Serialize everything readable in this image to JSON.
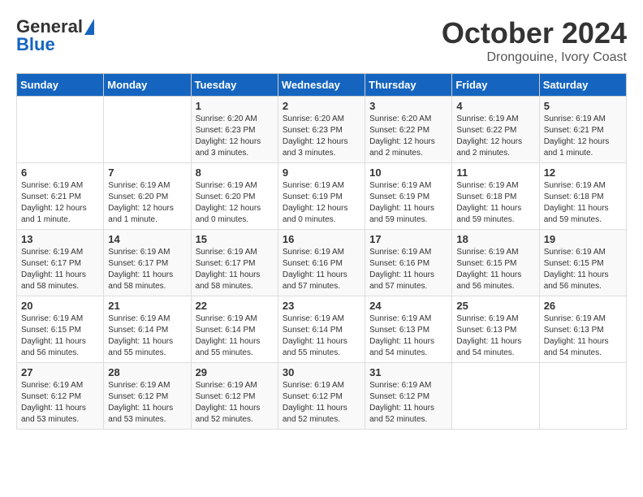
{
  "header": {
    "logo_line1": "General",
    "logo_line2": "Blue",
    "month": "October 2024",
    "location": "Drongouine, Ivory Coast"
  },
  "days_of_week": [
    "Sunday",
    "Monday",
    "Tuesday",
    "Wednesday",
    "Thursday",
    "Friday",
    "Saturday"
  ],
  "weeks": [
    [
      {
        "day": "",
        "info": ""
      },
      {
        "day": "",
        "info": ""
      },
      {
        "day": "1",
        "info": "Sunrise: 6:20 AM\nSunset: 6:23 PM\nDaylight: 12 hours and 3 minutes."
      },
      {
        "day": "2",
        "info": "Sunrise: 6:20 AM\nSunset: 6:23 PM\nDaylight: 12 hours and 3 minutes."
      },
      {
        "day": "3",
        "info": "Sunrise: 6:20 AM\nSunset: 6:22 PM\nDaylight: 12 hours and 2 minutes."
      },
      {
        "day": "4",
        "info": "Sunrise: 6:19 AM\nSunset: 6:22 PM\nDaylight: 12 hours and 2 minutes."
      },
      {
        "day": "5",
        "info": "Sunrise: 6:19 AM\nSunset: 6:21 PM\nDaylight: 12 hours and 1 minute."
      }
    ],
    [
      {
        "day": "6",
        "info": "Sunrise: 6:19 AM\nSunset: 6:21 PM\nDaylight: 12 hours and 1 minute."
      },
      {
        "day": "7",
        "info": "Sunrise: 6:19 AM\nSunset: 6:20 PM\nDaylight: 12 hours and 1 minute."
      },
      {
        "day": "8",
        "info": "Sunrise: 6:19 AM\nSunset: 6:20 PM\nDaylight: 12 hours and 0 minutes."
      },
      {
        "day": "9",
        "info": "Sunrise: 6:19 AM\nSunset: 6:19 PM\nDaylight: 12 hours and 0 minutes."
      },
      {
        "day": "10",
        "info": "Sunrise: 6:19 AM\nSunset: 6:19 PM\nDaylight: 11 hours and 59 minutes."
      },
      {
        "day": "11",
        "info": "Sunrise: 6:19 AM\nSunset: 6:18 PM\nDaylight: 11 hours and 59 minutes."
      },
      {
        "day": "12",
        "info": "Sunrise: 6:19 AM\nSunset: 6:18 PM\nDaylight: 11 hours and 59 minutes."
      }
    ],
    [
      {
        "day": "13",
        "info": "Sunrise: 6:19 AM\nSunset: 6:17 PM\nDaylight: 11 hours and 58 minutes."
      },
      {
        "day": "14",
        "info": "Sunrise: 6:19 AM\nSunset: 6:17 PM\nDaylight: 11 hours and 58 minutes."
      },
      {
        "day": "15",
        "info": "Sunrise: 6:19 AM\nSunset: 6:17 PM\nDaylight: 11 hours and 58 minutes."
      },
      {
        "day": "16",
        "info": "Sunrise: 6:19 AM\nSunset: 6:16 PM\nDaylight: 11 hours and 57 minutes."
      },
      {
        "day": "17",
        "info": "Sunrise: 6:19 AM\nSunset: 6:16 PM\nDaylight: 11 hours and 57 minutes."
      },
      {
        "day": "18",
        "info": "Sunrise: 6:19 AM\nSunset: 6:15 PM\nDaylight: 11 hours and 56 minutes."
      },
      {
        "day": "19",
        "info": "Sunrise: 6:19 AM\nSunset: 6:15 PM\nDaylight: 11 hours and 56 minutes."
      }
    ],
    [
      {
        "day": "20",
        "info": "Sunrise: 6:19 AM\nSunset: 6:15 PM\nDaylight: 11 hours and 56 minutes."
      },
      {
        "day": "21",
        "info": "Sunrise: 6:19 AM\nSunset: 6:14 PM\nDaylight: 11 hours and 55 minutes."
      },
      {
        "day": "22",
        "info": "Sunrise: 6:19 AM\nSunset: 6:14 PM\nDaylight: 11 hours and 55 minutes."
      },
      {
        "day": "23",
        "info": "Sunrise: 6:19 AM\nSunset: 6:14 PM\nDaylight: 11 hours and 55 minutes."
      },
      {
        "day": "24",
        "info": "Sunrise: 6:19 AM\nSunset: 6:13 PM\nDaylight: 11 hours and 54 minutes."
      },
      {
        "day": "25",
        "info": "Sunrise: 6:19 AM\nSunset: 6:13 PM\nDaylight: 11 hours and 54 minutes."
      },
      {
        "day": "26",
        "info": "Sunrise: 6:19 AM\nSunset: 6:13 PM\nDaylight: 11 hours and 54 minutes."
      }
    ],
    [
      {
        "day": "27",
        "info": "Sunrise: 6:19 AM\nSunset: 6:12 PM\nDaylight: 11 hours and 53 minutes."
      },
      {
        "day": "28",
        "info": "Sunrise: 6:19 AM\nSunset: 6:12 PM\nDaylight: 11 hours and 53 minutes."
      },
      {
        "day": "29",
        "info": "Sunrise: 6:19 AM\nSunset: 6:12 PM\nDaylight: 11 hours and 52 minutes."
      },
      {
        "day": "30",
        "info": "Sunrise: 6:19 AM\nSunset: 6:12 PM\nDaylight: 11 hours and 52 minutes."
      },
      {
        "day": "31",
        "info": "Sunrise: 6:19 AM\nSunset: 6:12 PM\nDaylight: 11 hours and 52 minutes."
      },
      {
        "day": "",
        "info": ""
      },
      {
        "day": "",
        "info": ""
      }
    ]
  ]
}
